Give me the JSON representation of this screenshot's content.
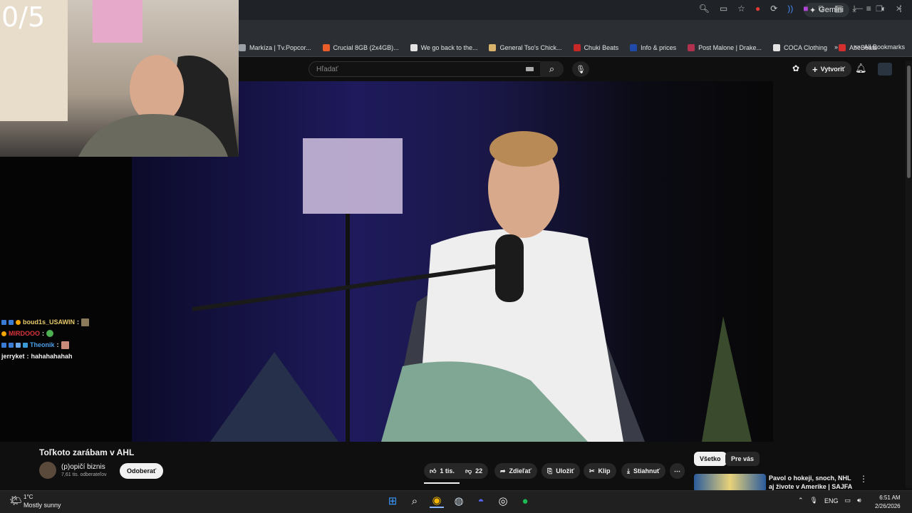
{
  "overlay": {
    "counter": "0/5",
    "chat": [
      {
        "user": "boud1s_USAWIN",
        "color": "#e8c96a",
        "message": "",
        "badges": [
          "#3a7bd5",
          "#3a7bd5",
          "#f0a500"
        ]
      },
      {
        "user": "MIRDOOO",
        "color": "#d9343b",
        "message": "",
        "badges": [
          "#f0a500"
        ]
      },
      {
        "user": "Theonik",
        "color": "#4aa0e6",
        "message": "",
        "badges": [
          "#3a7bd5",
          "#3a7bd5",
          "#3a7bd5",
          "#3a7bd5"
        ]
      },
      {
        "user": "jerryket",
        "color": "#f1f1f1",
        "message": "hahahahahah",
        "badges": []
      }
    ]
  },
  "browser": {
    "gemini_label": "Gemini",
    "bookmarks": [
      {
        "label": "Markíza | Tv.Popcor...",
        "color": "#9aa0a6"
      },
      {
        "label": "Crucial 8GB (2x4GB)...",
        "color": "#e85d2a"
      },
      {
        "label": "We go back to the...",
        "color": "#e3e3e3"
      },
      {
        "label": "General Tso's Chick...",
        "color": "#d9b36a"
      },
      {
        "label": "Chuki Beats",
        "color": "#c62828"
      },
      {
        "label": "Info & prices",
        "color": "#1f4aa8"
      },
      {
        "label": "Post Malone | Drake...",
        "color": "#b0304e"
      },
      {
        "label": "COCA Clothing",
        "color": "#e3e3e3"
      },
      {
        "label": "AbeBeats",
        "color": "#d32f2f"
      }
    ],
    "all_bookmarks": "All Bookmarks"
  },
  "youtube": {
    "search_placeholder": "Hľadať",
    "create_label": "Vytvoriť",
    "video_title": "Toľkoto zarábam v AHL",
    "channel_name": "(p)opičí biznis",
    "subscribers": "7,61 tis. odberateľov",
    "subscribe_label": "Odoberať",
    "actions": {
      "likes": "1 tis.",
      "dislikes": "22",
      "share": "Zdieľať",
      "save": "Uložiť",
      "clip": "Klip",
      "download": "Stiahnuť"
    },
    "chips": [
      "Všetko",
      "Pre vás"
    ],
    "recommendation": {
      "title": "Pavol o hokeji, snoch, NHL aj živote v Amerike | SAJFA ŠOU"
    }
  },
  "taskbar": {
    "weather_temp": "1°C",
    "weather_condition": "Mostly sunny",
    "language": "ENG",
    "time": "6:51 AM",
    "date": "2/26/2026"
  }
}
